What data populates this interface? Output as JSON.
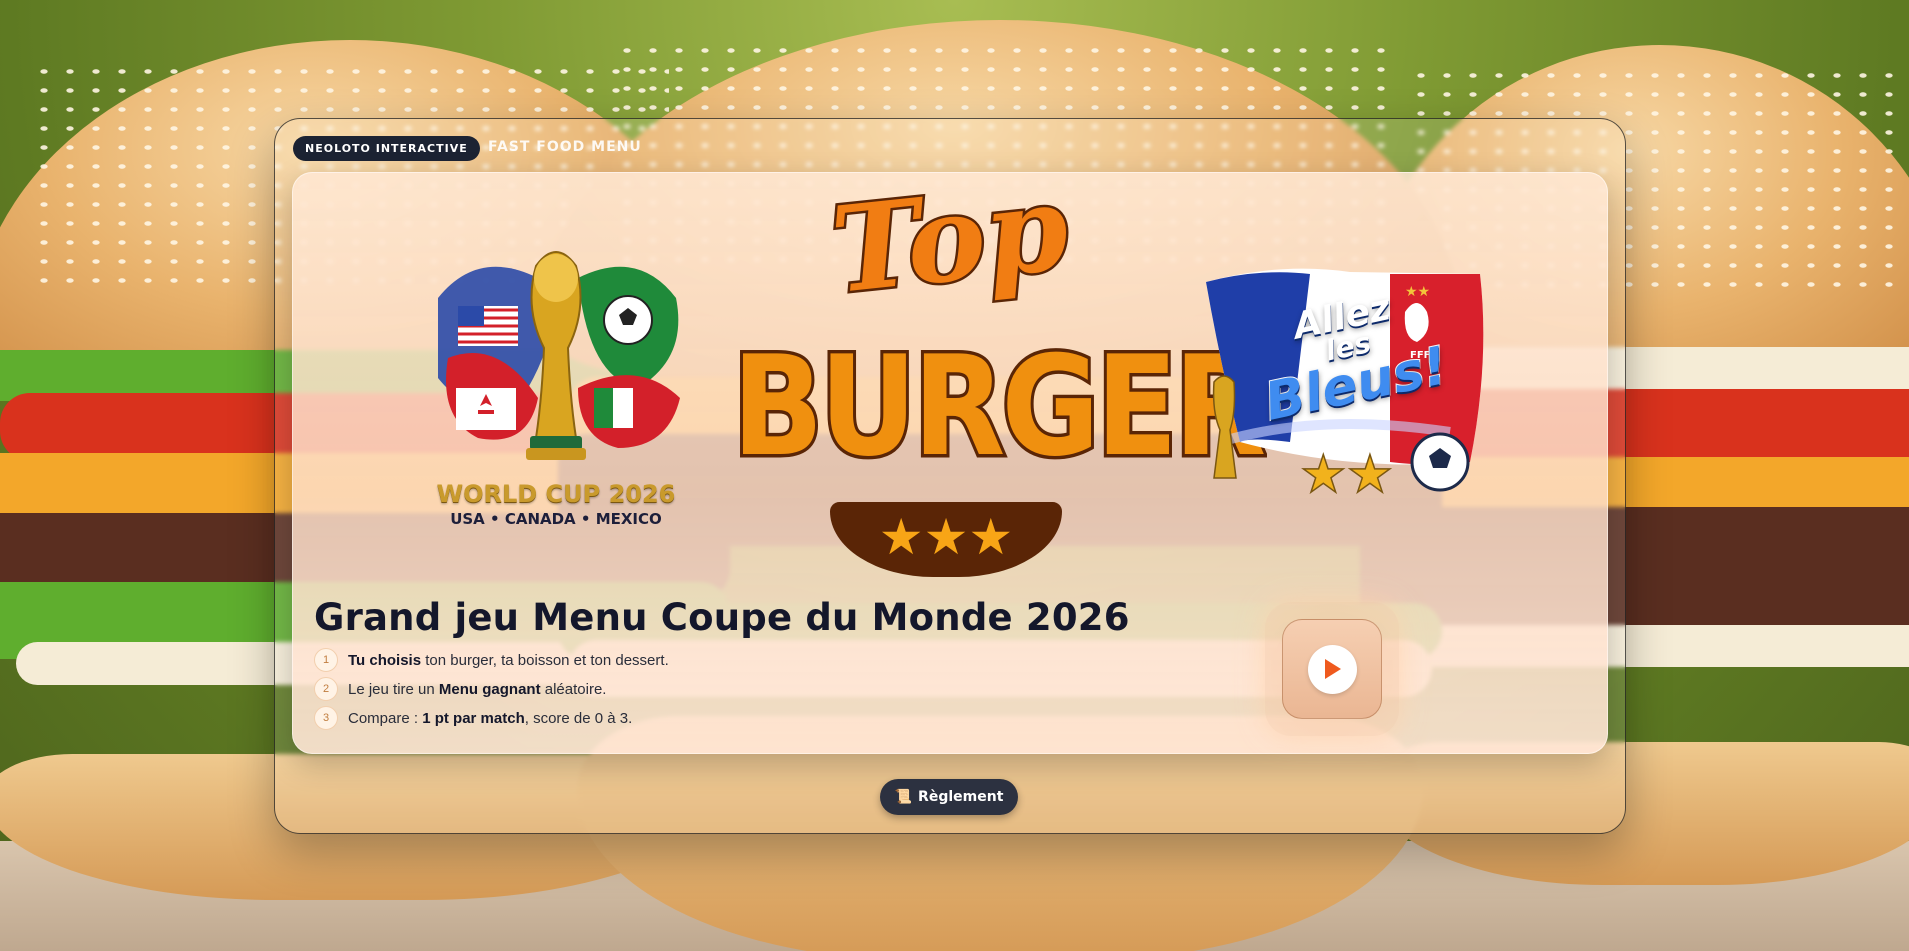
{
  "header": {
    "badge": "NEOLOTO INTERACTIVE",
    "subtitle": "FAST FOOD MENU"
  },
  "logos": {
    "world_cup": {
      "title": "WORLD CUP 2026",
      "subtitle": "USA • CANADA • MEXICO"
    },
    "top_burger": {
      "line1": "Top",
      "line2": "BURGER",
      "stars": "★★★"
    },
    "allez_les_bleus": {
      "line1": "Allez",
      "line2": "les",
      "line3": "Bleus!"
    }
  },
  "game": {
    "title": "Grand jeu Menu Coupe du Monde 2026",
    "steps": [
      {
        "num": "1",
        "bold": "Tu choisis",
        "text": " ton burger, ta boisson et ton dessert."
      },
      {
        "num": "2",
        "pre": "Le jeu tire un ",
        "bold": "Menu gagnant",
        "text": " aléatoire."
      },
      {
        "num": "3",
        "pre": "Compare : ",
        "bold": "1 pt par match",
        "text": ", score de 0 à 3."
      }
    ]
  },
  "buttons": {
    "play_icon": "play-icon",
    "rules_icon": "📜",
    "rules_label": "Règlement"
  },
  "colors": {
    "accent_orange": "#f0900f",
    "brand_brown": "#5a2506",
    "dark_navy": "#14172b",
    "badge_bg": "#1c2333"
  }
}
